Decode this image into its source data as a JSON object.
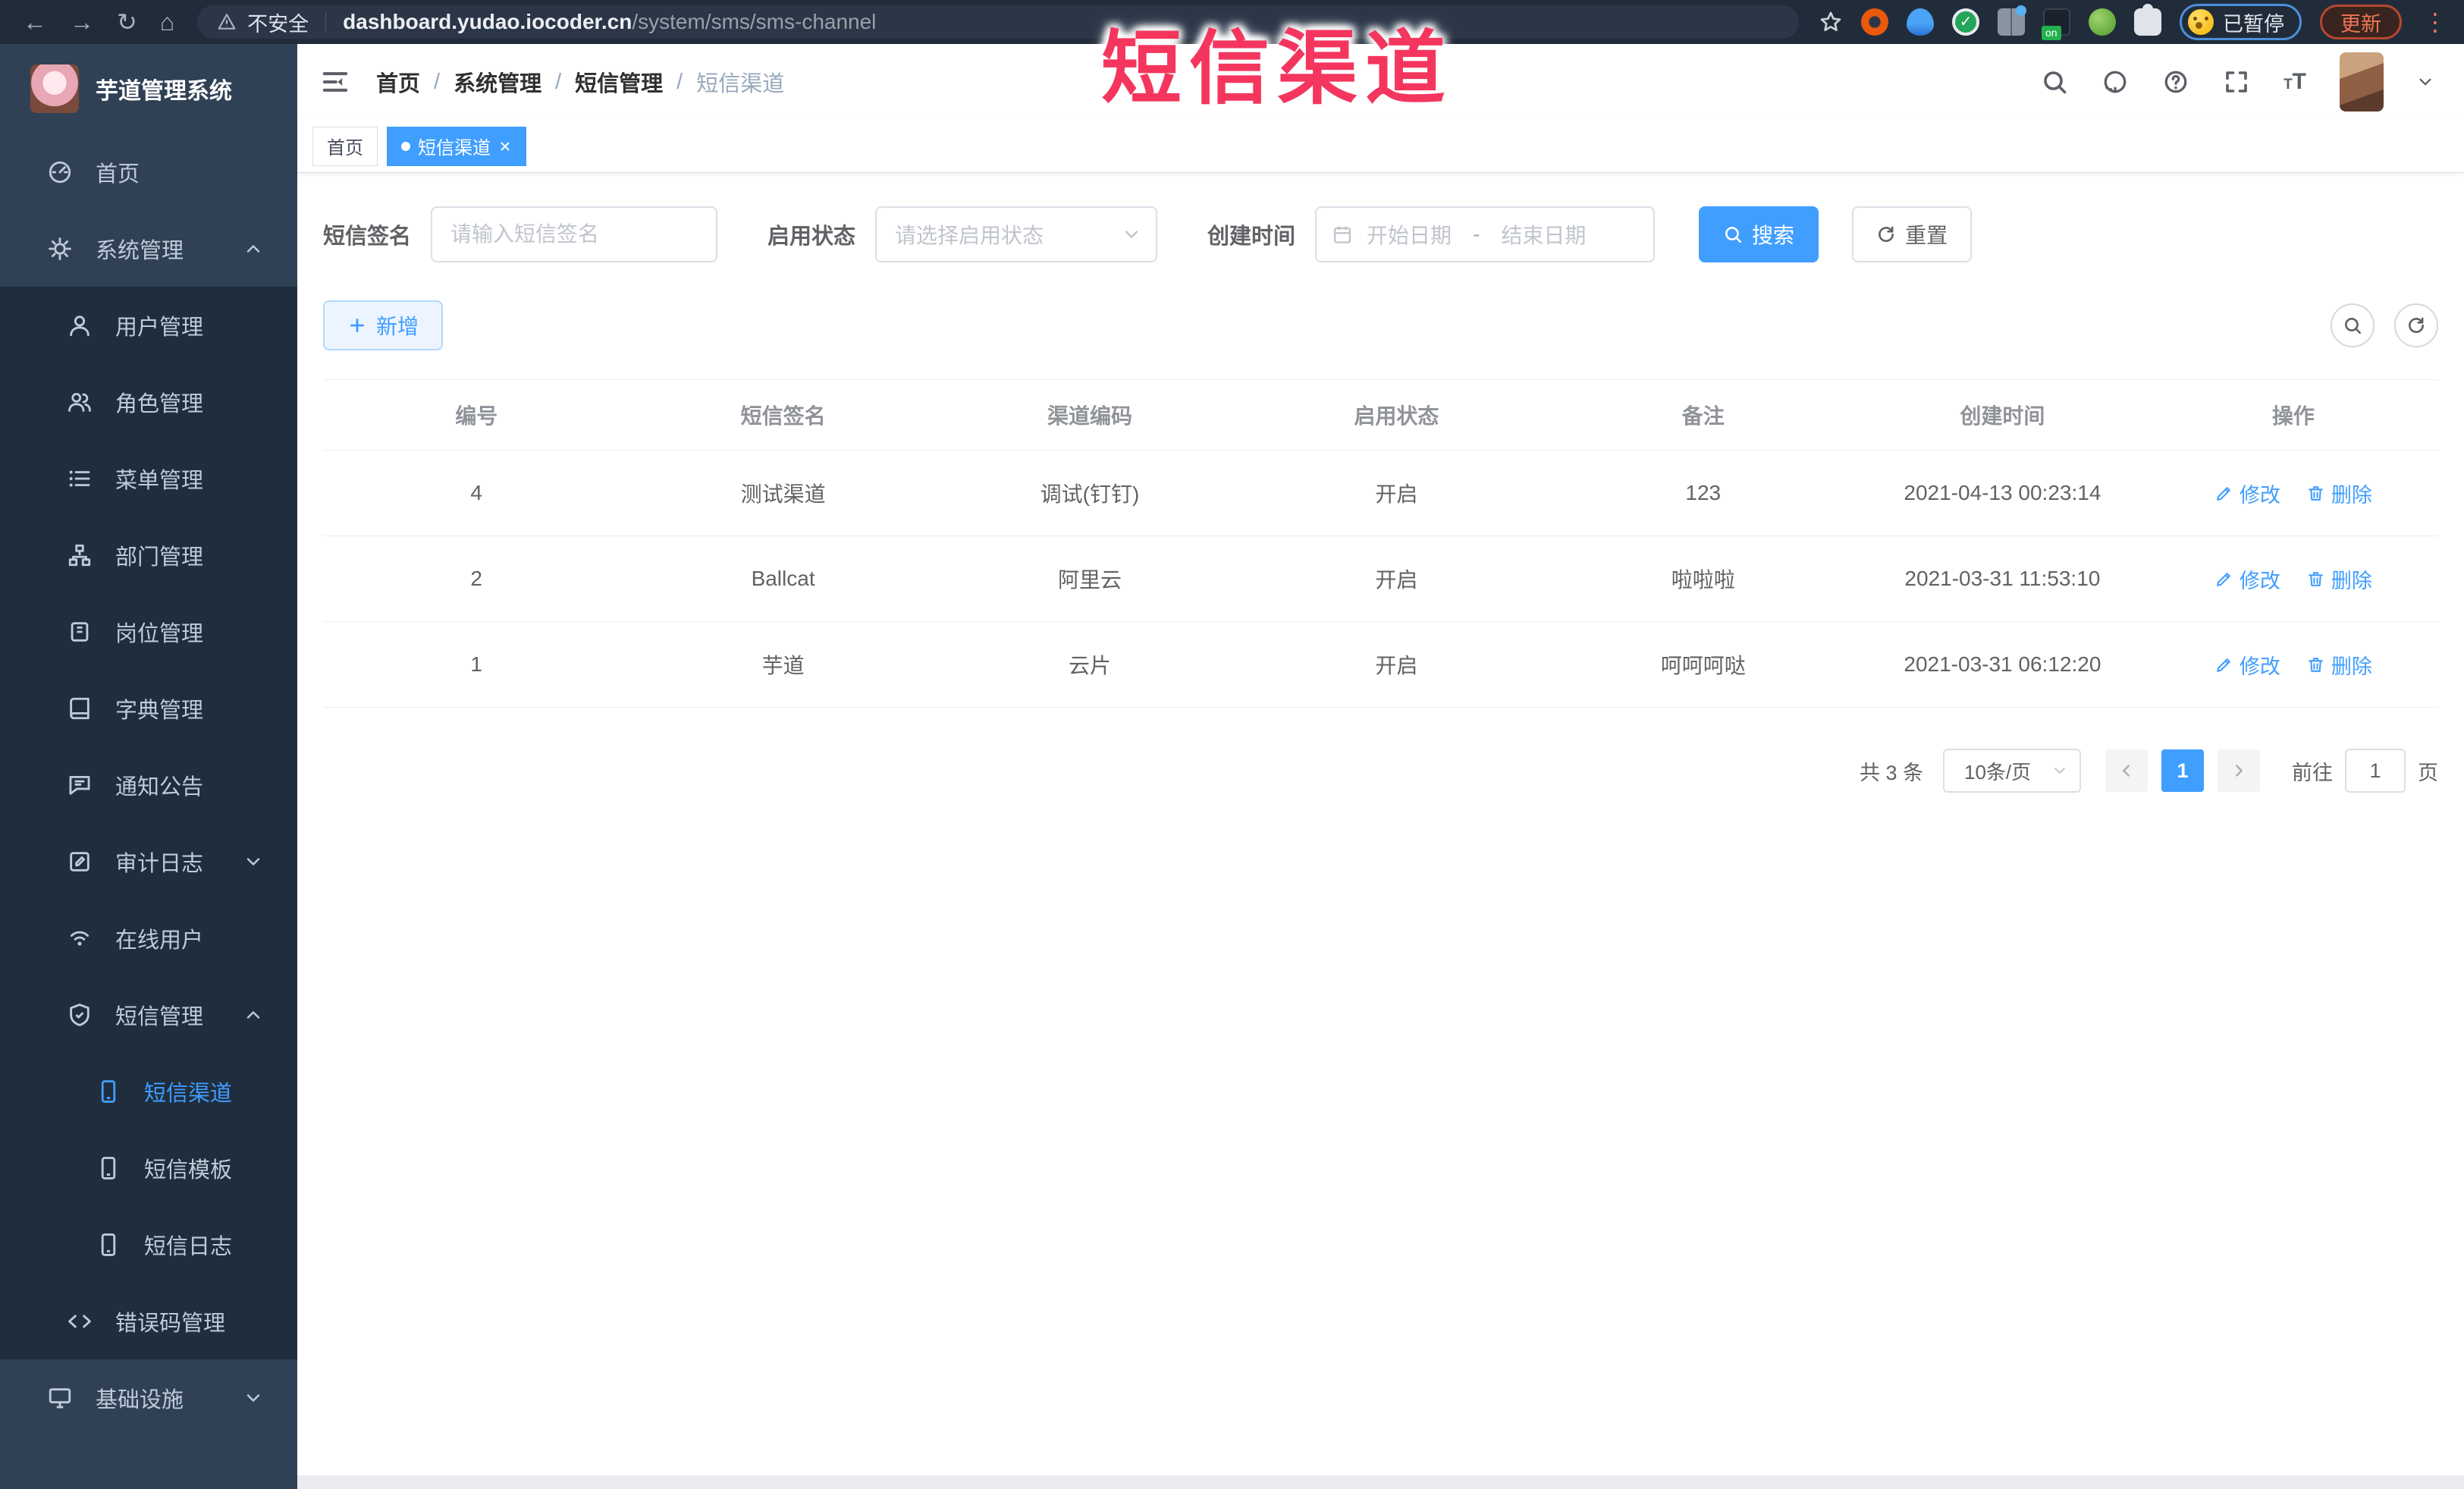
{
  "colors": {
    "primary": "#409eff",
    "overlay": "#f4365e",
    "sidebar_bg": "#304156",
    "submenu_bg": "#1f2d3d",
    "browser_bar": "#212c3a"
  },
  "browser": {
    "security_label": "不安全",
    "url_domain": "dashboard.yudao.iocoder.cn",
    "url_path": "/system/sms/sms-channel",
    "extension_badge": "on",
    "paused_badge": "已暂停",
    "update_button": "更新"
  },
  "overlay_title": "短信渠道",
  "sidebar": {
    "logo_title": "芋道管理系统",
    "items": [
      {
        "label": "首页",
        "icon": "gauge",
        "level": 1
      },
      {
        "label": "系统管理",
        "icon": "gear",
        "level": 1,
        "chevron": "up"
      },
      {
        "label": "用户管理",
        "icon": "user",
        "level": 2
      },
      {
        "label": "角色管理",
        "icon": "users",
        "level": 2
      },
      {
        "label": "菜单管理",
        "icon": "list",
        "level": 2
      },
      {
        "label": "部门管理",
        "icon": "tree",
        "level": 2
      },
      {
        "label": "岗位管理",
        "icon": "badge",
        "level": 2
      },
      {
        "label": "字典管理",
        "icon": "book",
        "level": 2
      },
      {
        "label": "通知公告",
        "icon": "bubble",
        "level": 2
      },
      {
        "label": "审计日志",
        "icon": "editsq",
        "level": 2,
        "chevron": "down"
      },
      {
        "label": "在线用户",
        "icon": "wifi",
        "level": 2
      },
      {
        "label": "短信管理",
        "icon": "shield",
        "level": 2,
        "chevron": "up"
      },
      {
        "label": "短信渠道",
        "icon": "phone",
        "level": 3,
        "active": true
      },
      {
        "label": "短信模板",
        "icon": "phone",
        "level": 3
      },
      {
        "label": "短信日志",
        "icon": "phone",
        "level": 3
      },
      {
        "label": "错误码管理",
        "icon": "code",
        "level": 2
      },
      {
        "label": "基础设施",
        "icon": "monitor",
        "level": 1,
        "chevron": "down"
      }
    ]
  },
  "breadcrumb": [
    "首页",
    "系统管理",
    "短信管理",
    "短信渠道"
  ],
  "breadcrumb_separator": "/",
  "tabs": [
    {
      "label": "首页",
      "active": false,
      "closable": false
    },
    {
      "label": "短信渠道",
      "active": true,
      "closable": true
    }
  ],
  "filters": {
    "sign_label": "短信签名",
    "sign_placeholder": "请输入短信签名",
    "status_label": "启用状态",
    "status_placeholder": "请选择启用状态",
    "time_label": "创建时间",
    "start_placeholder": "开始日期",
    "range_separator": "-",
    "end_placeholder": "结束日期",
    "search": "搜索",
    "reset": "重置"
  },
  "toolbar": {
    "add": "新增"
  },
  "table": {
    "columns": [
      "编号",
      "短信签名",
      "渠道编码",
      "启用状态",
      "备注",
      "创建时间",
      "操作"
    ],
    "rows": [
      {
        "id": "4",
        "sign": "测试渠道",
        "code": "调试(钉钉)",
        "status": "开启",
        "remark": "123",
        "created": "2021-04-13 00:23:14"
      },
      {
        "id": "2",
        "sign": "Ballcat",
        "code": "阿里云",
        "status": "开启",
        "remark": "啦啦啦",
        "created": "2021-03-31 11:53:10"
      },
      {
        "id": "1",
        "sign": "芋道",
        "code": "云片",
        "status": "开启",
        "remark": "呵呵呵哒",
        "created": "2021-03-31 06:12:20"
      }
    ],
    "edit": "修改",
    "delete": "删除"
  },
  "pagination": {
    "total": "共 3 条",
    "page_size": "10条/页",
    "current": "1",
    "goto": "前往",
    "goto_value": "1",
    "page_suffix": "页"
  }
}
